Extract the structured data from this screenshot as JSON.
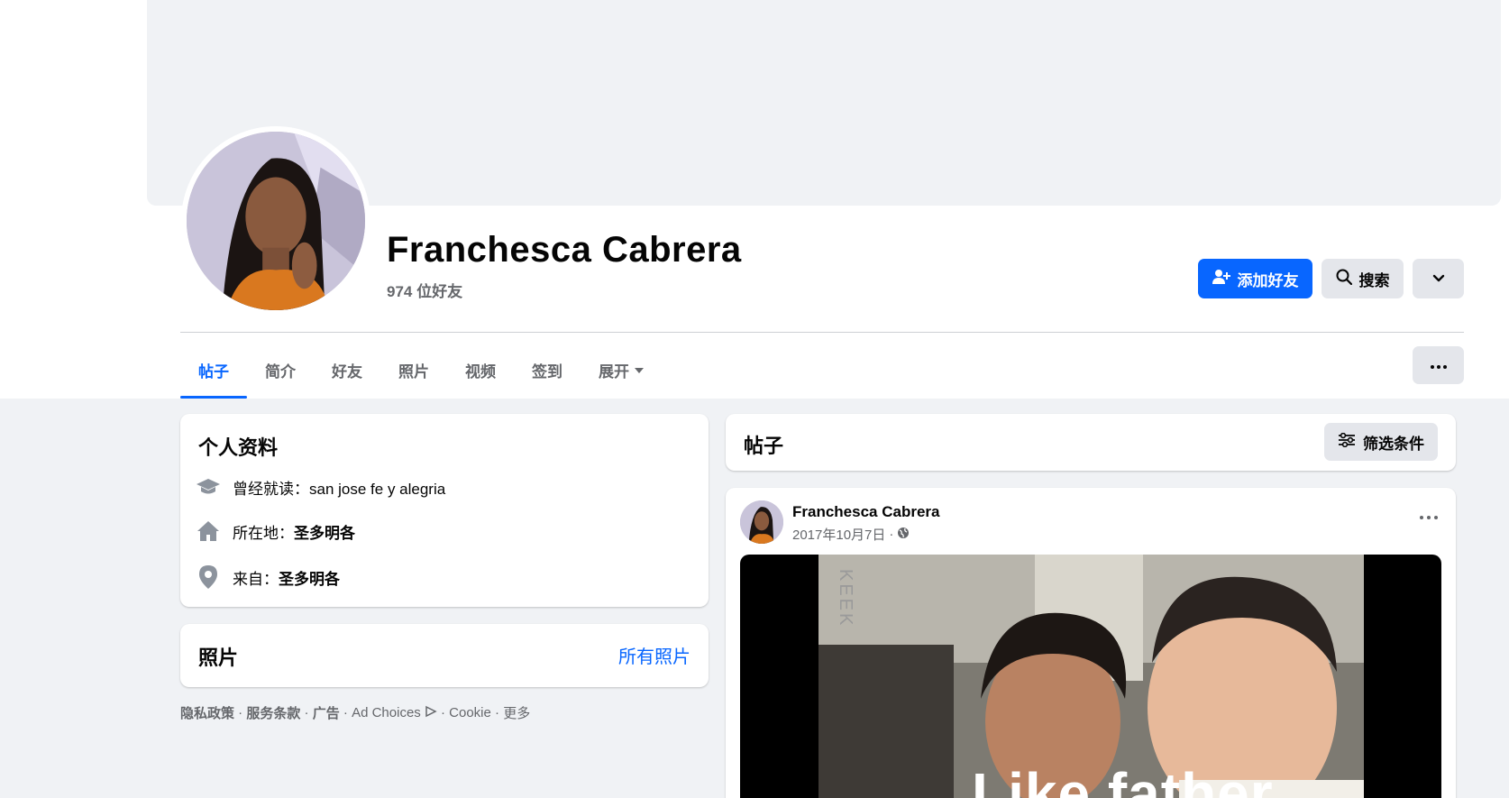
{
  "profile": {
    "name": "Franchesca Cabrera",
    "friend_count": "974 位好友"
  },
  "actions": {
    "add_friend": "添加好友",
    "search": "搜索"
  },
  "tabs": [
    {
      "label": "帖子",
      "active": true
    },
    {
      "label": "简介"
    },
    {
      "label": "好友"
    },
    {
      "label": "照片"
    },
    {
      "label": "视频"
    },
    {
      "label": "签到"
    },
    {
      "label": "展开"
    }
  ],
  "intro": {
    "title": "个人资料",
    "rows": [
      {
        "icon": "graduation-cap-icon",
        "label": "曾经就读：",
        "value": "san jose fe y alegria"
      },
      {
        "icon": "home-icon",
        "label": "所在地：",
        "value": "圣多明各"
      },
      {
        "icon": "location-pin-icon",
        "label": "来自：",
        "value": "圣多明各"
      }
    ]
  },
  "photos": {
    "title": "照片",
    "link": "所有照片"
  },
  "footer": {
    "privacy": "隐私政策",
    "terms": "服务条款",
    "ads": "广告",
    "ad_choices": "Ad Choices",
    "cookie": "Cookie",
    "more": "更多"
  },
  "posts": {
    "title": "帖子",
    "filter": "筛选条件"
  },
  "post": {
    "author": "Franchesca Cabrera",
    "date": "2017年10月7日",
    "watermark": "KEEK",
    "caption": "Like father"
  },
  "colors": {
    "accent": "#0866ff",
    "background": "#f0f2f5",
    "secondary_button": "#e4e6eb",
    "muted_text": "#65676b"
  }
}
